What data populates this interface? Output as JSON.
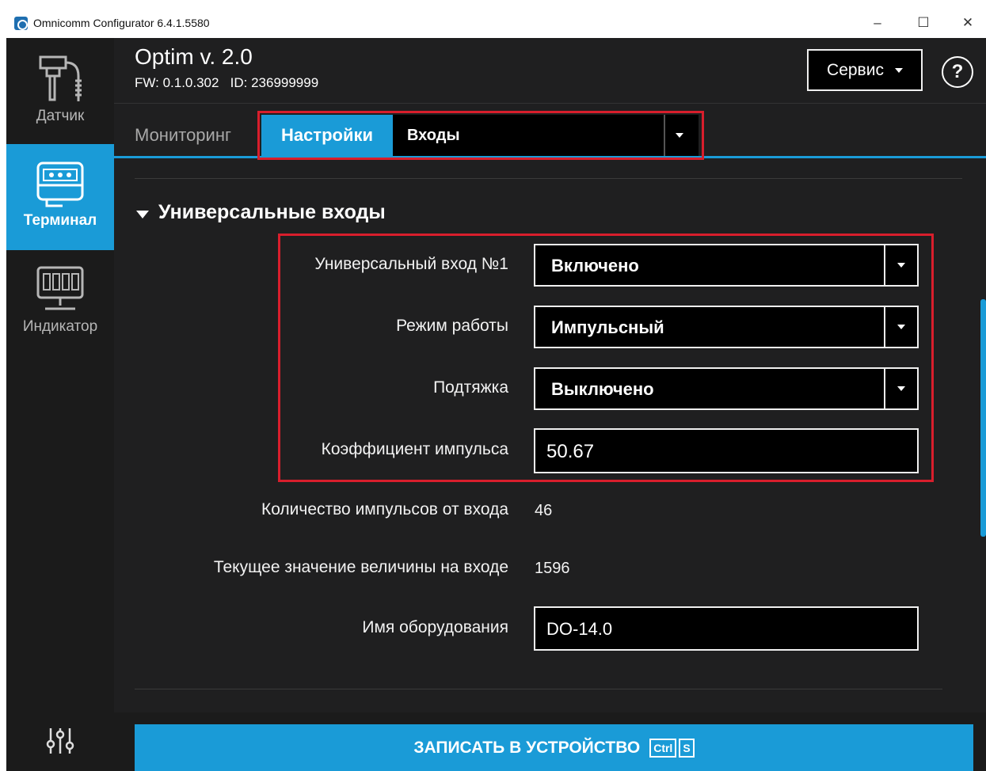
{
  "window": {
    "title": "Omnicomm Configurator 6.4.1.5580",
    "minimize_glyph": "–",
    "maximize_glyph": "☐",
    "close_glyph": "✕"
  },
  "sidebar": {
    "items": [
      {
        "label": "Датчик",
        "icon": "sensor-icon",
        "active": false
      },
      {
        "label": "Терминал",
        "icon": "terminal-icon",
        "active": true
      },
      {
        "label": "Индикатор",
        "icon": "indicator-icon",
        "active": false
      }
    ],
    "settings_icon": "sliders-icon"
  },
  "header": {
    "device_name": "Optim v. 2.0",
    "fw_id": "FW: 0.1.0.302   ID: 236999999",
    "service_label": "Сервис",
    "help_label": "?"
  },
  "tabs": {
    "monitoring": "Мониторинг",
    "settings": "Настройки",
    "section_select": "Входы"
  },
  "section": {
    "title": "Универсальные входы",
    "fields": [
      {
        "label": "Универсальный вход №1",
        "type": "select",
        "value": "Включено"
      },
      {
        "label": "Режим работы",
        "type": "select",
        "value": "Импульсный"
      },
      {
        "label": "Подтяжка",
        "type": "select",
        "value": "Выключено"
      },
      {
        "label": "Коэффициент импульса",
        "type": "input",
        "value": "50.67"
      },
      {
        "label": "Количество импульсов от входа",
        "type": "readonly",
        "value": "46"
      },
      {
        "label": "Текущее значение величины на входе",
        "type": "readonly",
        "value": "1596"
      },
      {
        "label": "Имя оборудования",
        "type": "input",
        "value": "DO-14.0"
      }
    ]
  },
  "footer": {
    "write_label": "ЗАПИСАТЬ В УСТРОЙСТВО",
    "shortcut_ctrl": "Ctrl",
    "shortcut_key": "S"
  },
  "colors": {
    "accent": "#1a9bd7",
    "highlight": "#d81e2c",
    "background": "#1f1f20"
  }
}
